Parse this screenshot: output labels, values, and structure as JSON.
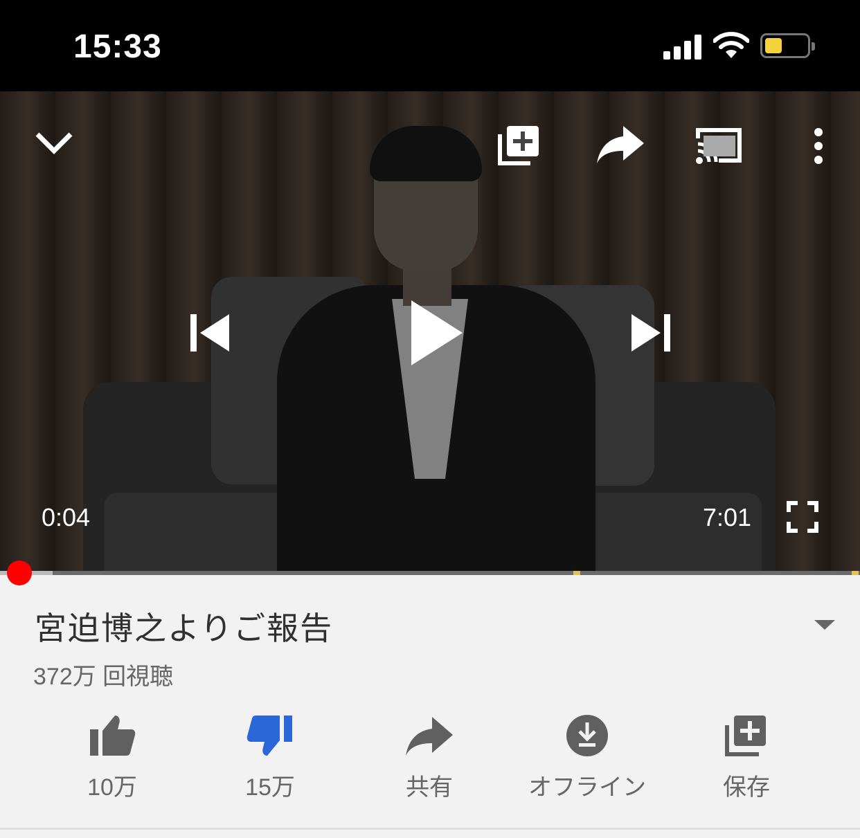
{
  "status_bar": {
    "time": "15:33"
  },
  "player": {
    "current_time": "0:04",
    "duration": "7:01",
    "progress_fraction": 0.01
  },
  "video": {
    "title": "宮迫博之よりご報告",
    "views": "372万 回視聴"
  },
  "actions": {
    "like": {
      "label": "10万",
      "icon": "thumb-up-icon"
    },
    "dislike": {
      "label": "15万",
      "icon": "thumb-down-icon",
      "color": "#2b67d6"
    },
    "share": {
      "label": "共有",
      "icon": "share-icon"
    },
    "offline": {
      "label": "オフライン",
      "icon": "download-icon"
    },
    "save": {
      "label": "保存",
      "icon": "playlist-add-icon"
    }
  },
  "colors": {
    "accent": "#ff0000",
    "dislike_active": "#2b67d6",
    "battery": "#f5d33a"
  }
}
